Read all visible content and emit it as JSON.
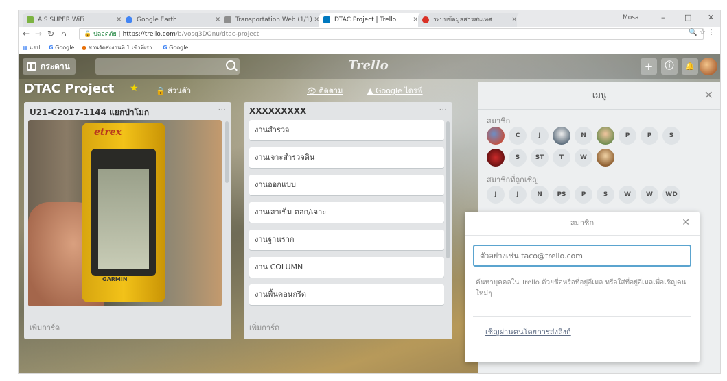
{
  "browser": {
    "tabs": [
      {
        "label": "AIS SUPER WiFi",
        "color": "#7cb342"
      },
      {
        "label": "Google Earth",
        "color": "#4285f4"
      },
      {
        "label": "Transportation Web (1/1)",
        "color": "#8e8e8e"
      },
      {
        "label": "DTAC Project | Trello",
        "color": "#0079bf"
      },
      {
        "label": "ระบบข้อมูลสารสนเทศ",
        "color": "#d93025"
      }
    ],
    "window_controls": [
      "–",
      "□",
      "✕"
    ],
    "window_user": "Mosa",
    "secure_label": "ปลอดภัย",
    "url_host": "https://trello.com",
    "url_path": "/b/vosq3DQnu/dtac-project",
    "bookmarks": [
      "แอป",
      "Google",
      "ชานจัดส่งงานที่ 1 เข้าที่เรา",
      "Google"
    ]
  },
  "trello": {
    "boards_label": "กระดาน",
    "logo": "Trello",
    "add_btn": "+",
    "info_btn": "ⓘ",
    "notif_btn": "🔔",
    "board_name": "DTAC Project",
    "star": "★",
    "private_label": "🔒 ส่วนตัว",
    "header_link_1": "ติดตาม",
    "header_link_2": "Google ไดรฟ์"
  },
  "lists": [
    {
      "title": "U21-C2017-1144 แยกป่าโมก",
      "menu": "···",
      "photo": {
        "device_label": "etrex",
        "brand": "GARMIN"
      },
      "add_card": "เพิ่มการ์ด"
    },
    {
      "title": "XXXXXXXXX",
      "menu": "···",
      "cards": [
        "งานสำรวจ",
        "งานเจาะสำรวจดิน",
        "งานออกแบบ",
        "งานเสาเข็ม ตอก/เจาะ",
        "งานฐานราก",
        "งาน COLUMN",
        "งานพื้นคอนกรีต"
      ],
      "add_card": "เพิ่มการ์ด"
    }
  ],
  "menu": {
    "title": "เมนู",
    "close": "✕",
    "members_label": "สมาชิก",
    "members": [
      {
        "initials": "",
        "photo": "photo1"
      },
      {
        "initials": "C"
      },
      {
        "initials": "J"
      },
      {
        "initials": "",
        "photo": "photo2"
      },
      {
        "initials": "N"
      },
      {
        "initials": "",
        "photo": "photo3"
      },
      {
        "initials": "P"
      },
      {
        "initials": "P"
      },
      {
        "initials": "S"
      },
      {
        "initials": "",
        "photo": "photo4"
      },
      {
        "initials": "S"
      },
      {
        "initials": "ST"
      },
      {
        "initials": "T"
      },
      {
        "initials": "W"
      },
      {
        "initials": "",
        "photo": "photo5"
      }
    ],
    "invited_label": "สมาชิกที่ถูกเชิญ",
    "invited": [
      "J",
      "J",
      "N",
      "PS",
      "P",
      "S",
      "W",
      "W",
      "WD"
    ]
  },
  "popover": {
    "title": "สมาชิก",
    "close": "✕",
    "placeholder": "ตัวอย่างเช่น taco@trello.com",
    "help": "ค้นหาบุคคลใน Trello ด้วยชื่อหรือที่อยู่อีเมล หรือใส่ที่อยู่อีเมลเพื่อเชิญคนใหม่ๆ",
    "link": "เชิญผ่านคนโดยการส่งลิงก์"
  }
}
